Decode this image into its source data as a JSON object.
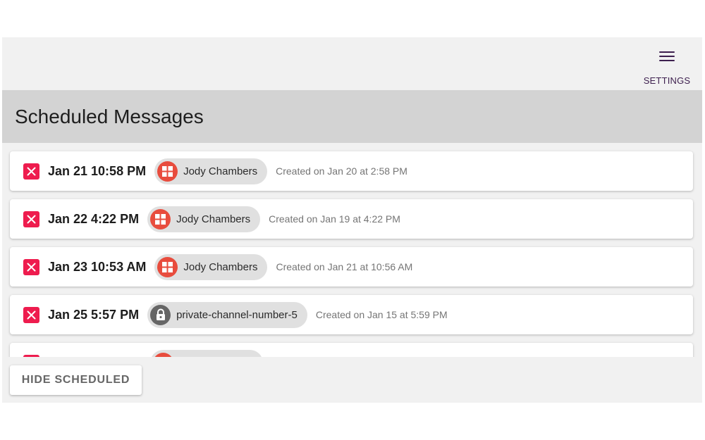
{
  "topbar": {
    "settings_label": "SETTINGS",
    "settings_icon": "hamburger-menu-icon"
  },
  "header": {
    "title": "Scheduled Messages"
  },
  "messages": [
    {
      "date": "Jan 21 10:58 PM",
      "recipient": "Jody Chambers",
      "recipient_type": "user",
      "created": "Created on Jan 20 at 2:58 PM"
    },
    {
      "date": "Jan 22 4:22 PM",
      "recipient": "Jody Chambers",
      "recipient_type": "user",
      "created": "Created on Jan 19 at 4:22 PM"
    },
    {
      "date": "Jan 23 10:53 AM",
      "recipient": "Jody Chambers",
      "recipient_type": "user",
      "created": "Created on Jan 21 at 10:56 AM"
    },
    {
      "date": "Jan 25 5:57 PM",
      "recipient": "private-channel-number-5",
      "recipient_type": "private-channel",
      "created": "Created on Jan 15 at 5:59 PM"
    },
    {
      "date": "",
      "recipient": "",
      "recipient_type": "user",
      "created": ""
    }
  ],
  "footer": {
    "hide_scheduled_label": "HIDE SCHEDULED"
  },
  "colors": {
    "delete": "#ee1c4e",
    "user_avatar": "#e84c3d",
    "lock_avatar": "#666666",
    "settings_accent": "#3d1f4e"
  }
}
